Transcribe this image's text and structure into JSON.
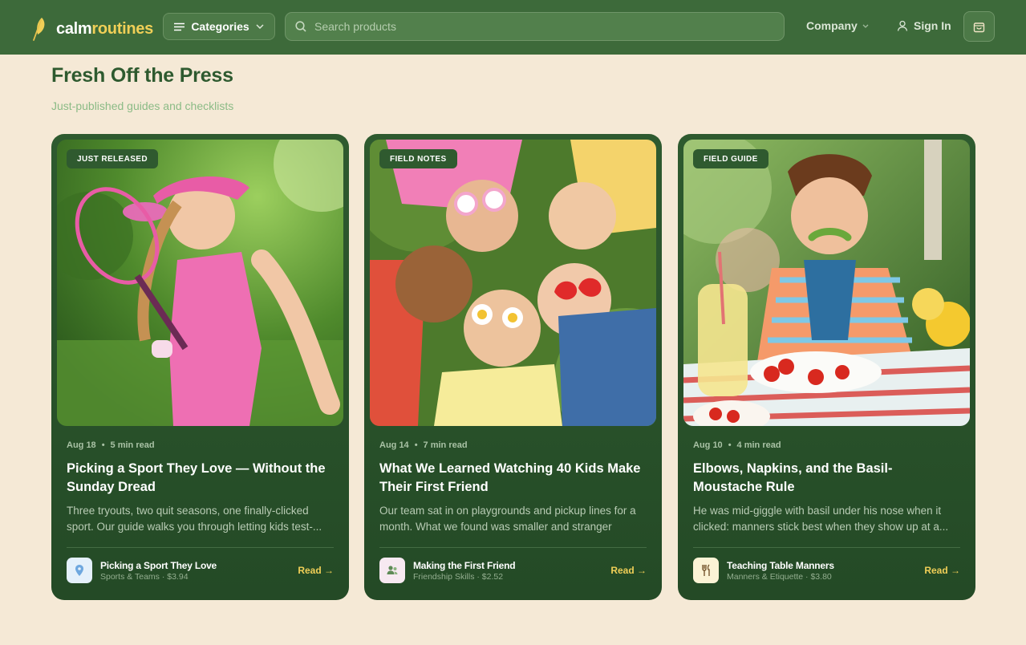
{
  "header": {
    "logo_part1": "calm",
    "logo_part2": "routines",
    "categories_label": "Categories",
    "search_placeholder": "Search products",
    "company_label": "Company",
    "signin_label": "Sign In",
    "icons": [
      "leaf-logo-icon",
      "menu-icon",
      "chevron-down-icon",
      "search-icon",
      "user-icon",
      "cart-icon"
    ],
    "colors": {
      "bar": "#3d6a3a",
      "accent": "#f0cf57"
    }
  },
  "section": {
    "title": "Fresh Off the Press",
    "subtitle": "Just-published guides and checklists"
  },
  "cards": [
    {
      "badge": "JUST RELEASED",
      "date": "Aug 18",
      "read_time": "5 min read",
      "title": "Picking a Sport They Love — Without the Sunday Dread",
      "desc": "Three tryouts, two quit seasons, one finally-clicked sport. Our guide walks you through letting kids test-...",
      "product_name": "Picking a Sport They Love",
      "product_meta": "Sports & Teams · $3.94",
      "product_icon": "location-pin-icon",
      "read_label": "Read →"
    },
    {
      "badge": "FIELD NOTES",
      "date": "Aug 14",
      "read_time": "7 min read",
      "title": "What We Learned Watching 40 Kids Make Their First Friend",
      "desc": "Our team sat in on playgrounds and pickup lines for a month. What we found was smaller and stranger than...",
      "product_name": "Making the First Friend",
      "product_meta": "Friendship Skills · $2.52",
      "product_icon": "people-icon",
      "read_label": "Read →"
    },
    {
      "badge": "FIELD GUIDE",
      "date": "Aug 10",
      "read_time": "4 min read",
      "title": "Elbows, Napkins, and the Basil-Moustache Rule",
      "desc": "He was mid-giggle with basil under his nose when it clicked: manners stick best when they show up at a...",
      "product_name": "Teaching Table Manners",
      "product_meta": "Manners & Etiquette · $3.80",
      "product_icon": "fork-knife-icon",
      "read_label": "Read →"
    }
  ]
}
